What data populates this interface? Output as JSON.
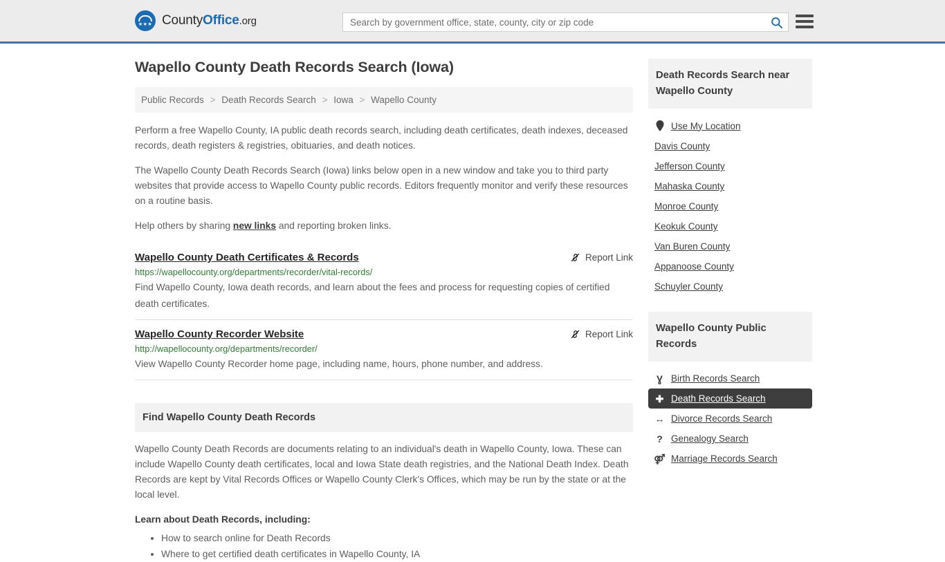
{
  "header": {
    "logo": {
      "part1": "County",
      "part2": "Office",
      "part3": ".org",
      "icon": "eagle-seal-icon"
    },
    "search": {
      "placeholder": "Search by government office, state, county, city or zip code",
      "value": ""
    },
    "search_icon": "search-icon",
    "menu_icon": "hamburger-menu-icon"
  },
  "main": {
    "title": "Wapello County Death Records Search (Iowa)",
    "breadcrumb": [
      {
        "label": "Public Records"
      },
      {
        "label": "Death Records Search"
      },
      {
        "label": "Iowa"
      },
      {
        "label": "Wapello County"
      }
    ],
    "breadcrumb_separator": ">",
    "paragraphs": {
      "p1": "Perform a free Wapello County, IA public death records search, including death certificates, death indexes, deceased records, death registers & registries, obituaries, and death notices.",
      "p2": "The Wapello County Death Records Search (Iowa) links below open in a new window and take you to third party websites that provide access to Wapello County public records. Editors frequently monitor and verify these resources on a routine basis.",
      "p3_before": "Help others by sharing ",
      "p3_link": "new links",
      "p3_after": " and reporting broken links."
    },
    "report_link_label": "Report Link",
    "report_link_icon": "broken-link-icon",
    "results": [
      {
        "title": "Wapello County Death Certificates & Records",
        "url": "https://wapellocounty.org/departments/recorder/vital-records/",
        "description": "Find Wapello County, Iowa death records, and learn about the fees and process for requesting copies of certified death certificates."
      },
      {
        "title": "Wapello County Recorder Website",
        "url": "http://wapellocounty.org/departments/recorder/",
        "description": "View Wapello County Recorder home page, including name, hours, phone number, and address."
      }
    ],
    "section": {
      "heading": "Find Wapello County Death Records",
      "body": "Wapello County Death Records are documents relating to an individual's death in Wapello County, Iowa. These can include Wapello County death certificates, local and Iowa State death registries, and the National Death Index. Death Records are kept by Vital Records Offices or Wapello County Clerk's Offices, which may be run by the state or at the local level.",
      "learn_heading": "Learn about Death Records, including:",
      "learn_items": [
        "How to search online for Death Records",
        "Where to get certified death certificates in Wapello County, IA"
      ]
    }
  },
  "sidebar": {
    "nearby_card": {
      "heading": "Death Records Search near Wapello County",
      "items": [
        {
          "label": "Use My Location",
          "icon": "map-pin-icon",
          "glyph": "•",
          "active": false
        },
        {
          "label": "Davis County",
          "icon": "",
          "glyph": "",
          "active": false
        },
        {
          "label": "Jefferson County",
          "icon": "",
          "glyph": "",
          "active": false
        },
        {
          "label": "Mahaska County",
          "icon": "",
          "glyph": "",
          "active": false
        },
        {
          "label": "Monroe County",
          "icon": "",
          "glyph": "",
          "active": false
        },
        {
          "label": "Keokuk County",
          "icon": "",
          "glyph": "",
          "active": false
        },
        {
          "label": "Van Buren County",
          "icon": "",
          "glyph": "",
          "active": false
        },
        {
          "label": "Appanoose County",
          "icon": "",
          "glyph": "",
          "active": false
        },
        {
          "label": "Schuyler County",
          "icon": "",
          "glyph": "",
          "active": false
        }
      ]
    },
    "records_card": {
      "heading": "Wapello County Public Records",
      "items": [
        {
          "label": "Birth Records Search",
          "icon": "baby-icon",
          "glyph": "Ɣ",
          "active": false
        },
        {
          "label": "Death Records Search",
          "icon": "cross-icon",
          "glyph": "✚",
          "active": true
        },
        {
          "label": "Divorce Records Search",
          "icon": "split-arrows-icon",
          "glyph": "↔",
          "active": false
        },
        {
          "label": "Genealogy Search",
          "icon": "question-mark-icon",
          "glyph": "?",
          "active": false
        },
        {
          "label": "Marriage Records Search",
          "icon": "male-female-icon",
          "glyph": "⚤",
          "active": false
        }
      ]
    }
  },
  "colors": {
    "header_bg": "#ececec",
    "header_border": "#3b76ac",
    "brand_blue": "#1a6bb5",
    "url_green": "#2f7d32",
    "active_bg": "#3d3d3d",
    "panel_bg": "#f2f2f2"
  }
}
